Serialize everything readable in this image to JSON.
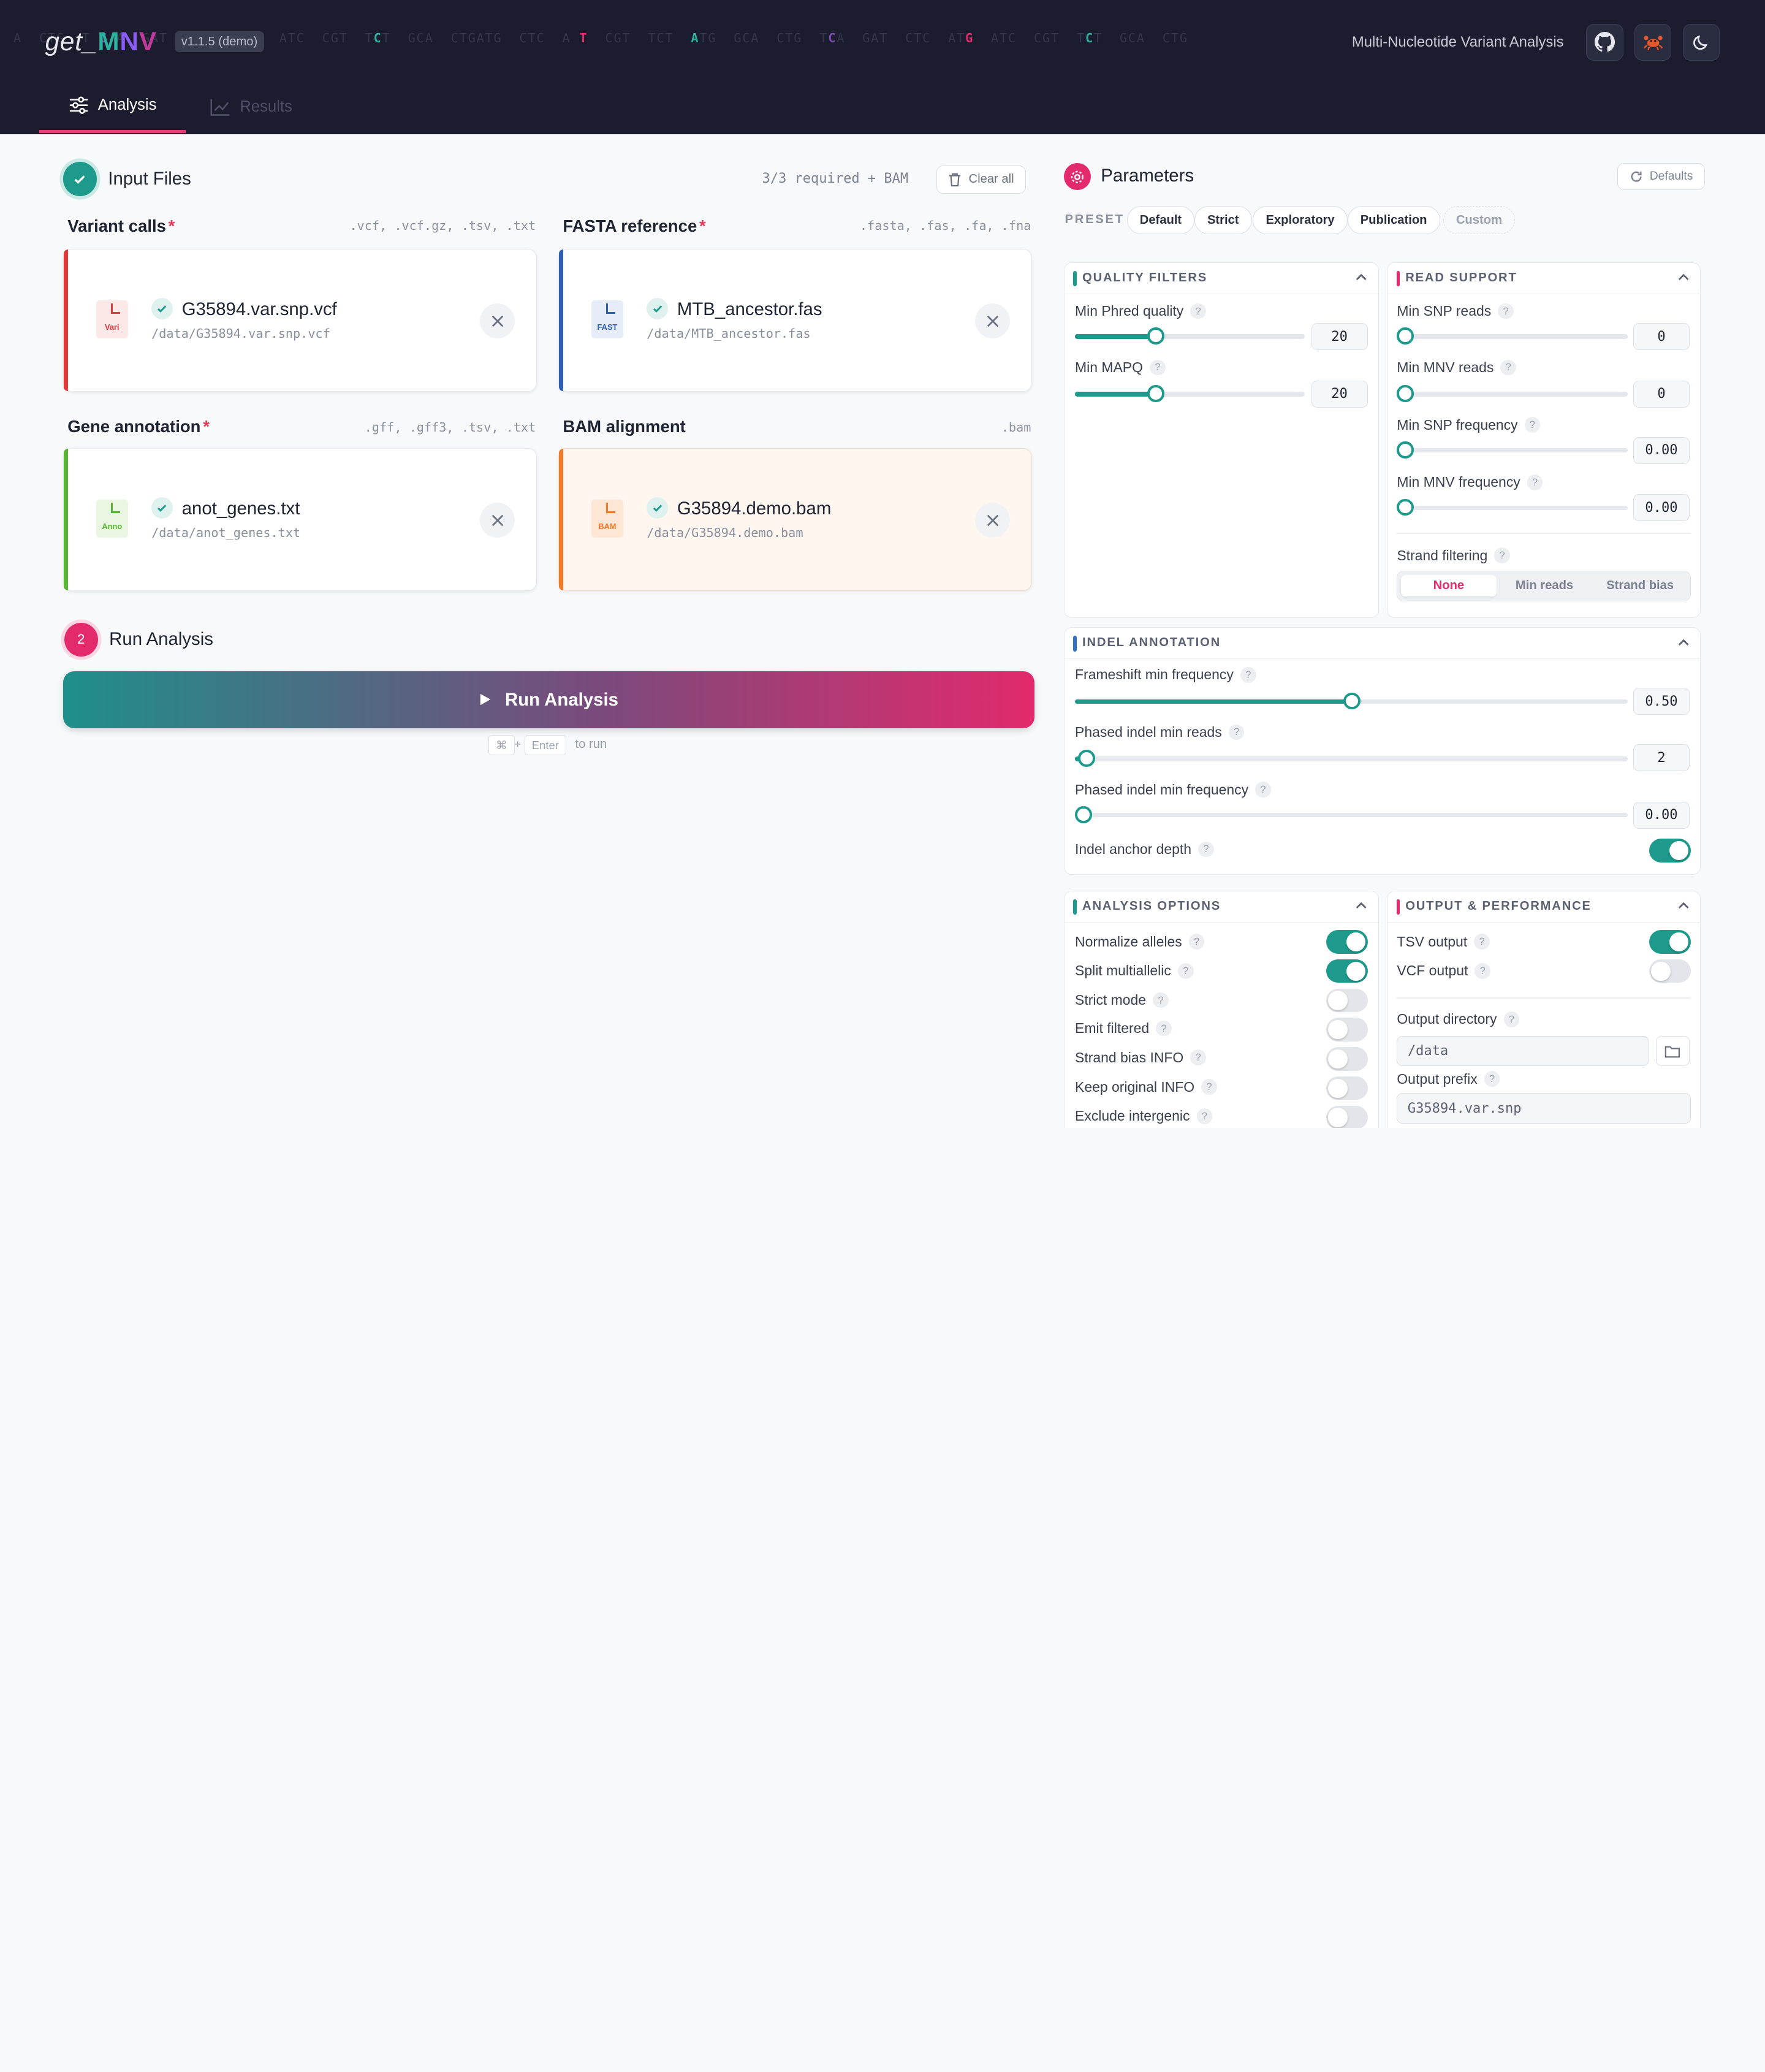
{
  "app": {
    "logo_prefix": "get_",
    "logo_m": "M",
    "logo_n": "N",
    "logo_v": "V",
    "version": "v1.1.5 (demo)",
    "subtitle": "Multi-Nucleotide Variant Analysis",
    "dna_text": "A  CTG  T C A  GAT  CTC  AT G  ATC  CGT  T C T  GCA  CTGATG  CTC  A T  CGT  TCT  ATG  GCA  CTG  T C A  GAT  CTC  AT G  ATC  CGT  T C T  GCA  CTG"
  },
  "tabs": [
    {
      "label": "Analysis"
    },
    {
      "label": "Results"
    }
  ],
  "input": {
    "title": "Input Files",
    "status": "3/3 required + BAM",
    "clear_all": "Clear all",
    "files": [
      {
        "label": "Variant calls",
        "required": "*",
        "ext": ".vcf, .vcf.gz, .tsv, .txt",
        "icon": "Vari",
        "name": "G35894.var.snp.vcf",
        "path": "/data/G35894.var.snp.vcf",
        "color": "#e03a3a"
      },
      {
        "label": "FASTA reference",
        "required": "*",
        "ext": ".fasta, .fas, .fa, .fna",
        "icon": "FAST",
        "name": "MTB_ancestor.fas",
        "path": "/data/MTB_ancestor.fas",
        "color": "#2f5fb0"
      },
      {
        "label": "Gene annotation",
        "required": "*",
        "ext": ".gff, .gff3, .tsv, .txt",
        "icon": "Anno",
        "name": "anot_genes.txt",
        "path": "/data/anot_genes.txt",
        "color": "#5ab534"
      },
      {
        "label": "BAM alignment",
        "required": "",
        "ext": ".bam",
        "icon": "BAM",
        "name": "G35894.demo.bam",
        "path": "/data/G35894.demo.bam",
        "color": "#ee7a2a"
      }
    ]
  },
  "run": {
    "step": "2",
    "title": "Run Analysis",
    "button": "Run Analysis",
    "kbd_cmd": "⌘",
    "kbd_plus": "+",
    "kbd_enter": "Enter",
    "kbd_hint": "to run"
  },
  "params": {
    "title": "Parameters",
    "defaults": "Defaults",
    "preset_label": "PRESET",
    "presets": [
      "Default",
      "Strict",
      "Exploratory",
      "Publication",
      "Custom"
    ],
    "quality": {
      "title": "QUALITY FILTERS",
      "min_phred_label": "Min Phred quality",
      "min_phred": "20",
      "min_phred_frac": 0.35,
      "min_mapq_label": "Min MAPQ",
      "min_mapq": "20",
      "min_mapq_frac": 0.35
    },
    "read_support": {
      "title": "READ SUPPORT",
      "min_snp_reads_label": "Min SNP reads",
      "min_snp_reads": "0",
      "min_mnv_reads_label": "Min MNV reads",
      "min_mnv_reads": "0",
      "min_snp_freq_label": "Min SNP frequency",
      "min_snp_freq": "0.00",
      "min_mnv_freq_label": "Min MNV frequency",
      "min_mnv_freq": "0.00",
      "strand_label": "Strand filtering",
      "strand_options": [
        "None",
        "Min reads",
        "Strand bias"
      ]
    },
    "indel": {
      "title": "INDEL ANNOTATION",
      "frameshift_label": "Frameshift min frequency",
      "frameshift": "0.50",
      "frameshift_frac": 0.5,
      "phased_reads_label": "Phased indel min reads",
      "phased_reads": "2",
      "phased_reads_frac": 0.02,
      "phased_freq_label": "Phased indel min frequency",
      "phased_freq": "0.00",
      "anchor_label": "Indel anchor depth"
    },
    "analysis_options": {
      "title": "ANALYSIS OPTIONS",
      "items": [
        {
          "label": "Normalize alleles",
          "on": true
        },
        {
          "label": "Split multiallelic",
          "on": true
        },
        {
          "label": "Strict mode",
          "on": false
        },
        {
          "label": "Emit filtered",
          "on": false
        },
        {
          "label": "Strand bias INFO",
          "on": false
        },
        {
          "label": "Keep original INFO",
          "on": false
        },
        {
          "label": "Exclude intergenic",
          "on": false
        }
      ]
    },
    "output": {
      "title": "OUTPUT & PERFORMANCE",
      "tsv_label": "TSV output",
      "vcf_label": "VCF output",
      "dir_label": "Output directory",
      "dir_value": "/data",
      "prefix_label": "Output prefix",
      "prefix_value": "G35894.var.snp"
    }
  }
}
